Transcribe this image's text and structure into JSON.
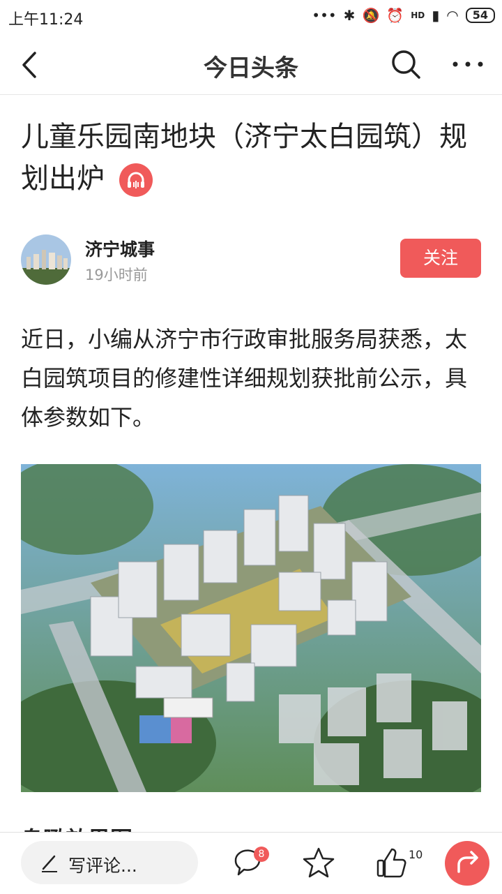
{
  "status": {
    "time": "上午11:24",
    "battery": "54",
    "network": "HD"
  },
  "nav": {
    "title": "今日头条"
  },
  "article": {
    "title": "儿童乐园南地块（济宁太白园筑）规划出炉",
    "author": "济宁城事",
    "time": "19小时前",
    "follow_label": "关注",
    "paragraph": "近日，小编从济宁市行政审批服务局获悉，太白园筑项目的修建性详细规划获批前公示，具体参数如下。",
    "next_heading_partial": "鸟瞰效果图"
  },
  "bottom": {
    "comment_placeholder": "写评论...",
    "comment_count": "8",
    "like_count": "10"
  },
  "colors": {
    "accent": "#f05a5a"
  }
}
